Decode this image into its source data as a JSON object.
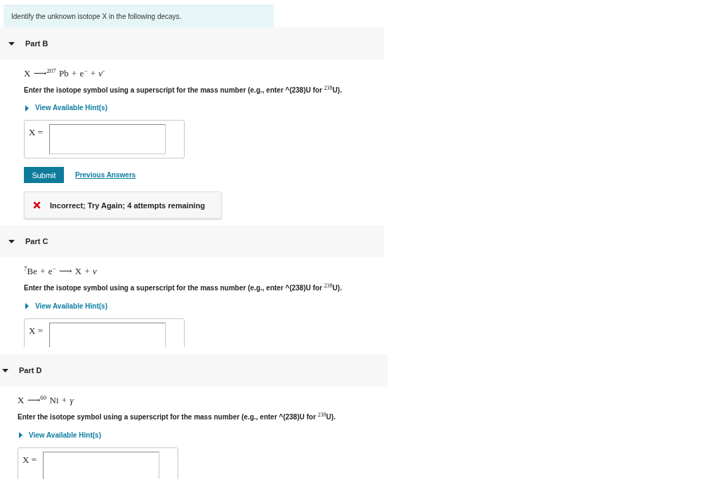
{
  "intro": "Identify the unknown isotope X in the following decays.",
  "parts": [
    {
      "title": "Part B",
      "expanded": true,
      "equation": "X ⟶$^{207}$ Pb + e$^{−}$ + *ν̄*",
      "instruction": "Enter the isotope symbol using a superscript for the mass number (e.g., enter ^(238)U for $^{238}$U).",
      "hint": {
        "label": "View Available Hint(s)",
        "expanded": false
      },
      "answer": {
        "label": "X ="
      },
      "submit": "Submit",
      "previous_answers": "Previous Answers",
      "feedback": {
        "kind": "incorrect",
        "text": "Incorrect; Try Again; 4 attempts remaining"
      }
    },
    {
      "title": "Part C",
      "expanded": true,
      "equation": "$^{7}$Be + e$^{−}$ ⟶ X + *ν*",
      "instruction": "Enter the isotope symbol using a superscript for the mass number (e.g., enter ^(238)U for $^{238}$U).",
      "hint": {
        "label": "View Available Hint(s)",
        "expanded": false
      },
      "answer": {
        "label": "X ="
      }
    },
    {
      "title": "Part D",
      "expanded": true,
      "equation": "X ⟶$^{60}$ Ni + *γ*",
      "instruction": "Enter the isotope symbol using a superscript for the mass number (e.g., enter ^(238)U for $^{238}$U).",
      "hint": {
        "label": "View Available Hint(s)",
        "expanded": false
      },
      "answer": {
        "label": "X ="
      }
    }
  ]
}
